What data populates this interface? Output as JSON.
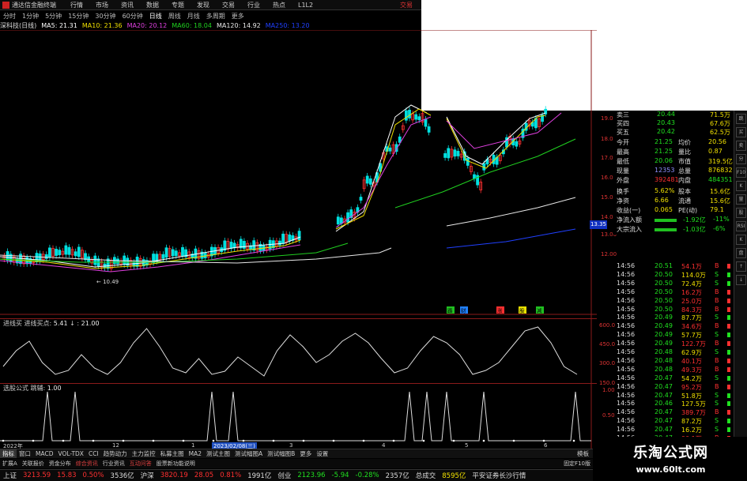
{
  "menubar": {
    "app_title": "通达信金融终端",
    "items": [
      "行情",
      "市场",
      "资讯",
      "数据",
      "专题",
      "发现",
      "交易",
      "行业",
      "热点",
      "L1L2"
    ],
    "right": "交易"
  },
  "periodbar": {
    "items": [
      "分时",
      "1分钟",
      "5分钟",
      "15分钟",
      "30分钟",
      "60分钟",
      "日线",
      "周线",
      "月线",
      "多周期",
      "更多"
    ],
    "active": 6
  },
  "ma_line": {
    "stock": "深科技(日线)",
    "items": [
      {
        "label": "MA5: 21.31",
        "color": "#ffffff"
      },
      {
        "label": "MA10: 21.36",
        "color": "#f0e000"
      },
      {
        "label": "MA20: 20.12",
        "color": "#e040e0"
      },
      {
        "label": "MA60: 18.04",
        "color": "#20d020"
      },
      {
        "label": "MA120: 14.92",
        "color": "#e8e8e8"
      },
      {
        "label": "MA250: 13.20",
        "color": "#2040ff"
      }
    ]
  },
  "axis": {
    "price": [
      "19.00",
      "18.00",
      "17.00",
      "16.00",
      "15.00",
      "14.00",
      "13.00",
      "12.00"
    ],
    "ind1": [
      "600.0",
      "450.0",
      "300.0",
      "150.0"
    ],
    "ind2": [
      "1.00",
      "0.50"
    ]
  },
  "price_tag": "13.35",
  "low_marker": "10.49",
  "indicators": {
    "ind1_title": "进线买",
    "ind1_label": "进线买点",
    "ind1_v1": "5.41",
    "ind1_v2": "21.00",
    "ind2_title": "选股公式",
    "ind2_label": "跳辅",
    "ind2_v": "1.00"
  },
  "quote": {
    "sells": [
      {
        "label": "卖三",
        "price": "20.44",
        "vol": "71.5万"
      },
      {
        "label": "买四",
        "price": "20.43",
        "vol": "67.6万"
      },
      {
        "label": "买五",
        "price": "20.42",
        "vol": "62.5万"
      }
    ],
    "stats": [
      {
        "l1": "今开",
        "v1": "21.25",
        "l2": "均价",
        "v2": "20.56"
      },
      {
        "l1": "最高",
        "v1": "21.25",
        "l2": "量比",
        "v2": "0.87"
      },
      {
        "l1": "最低",
        "v1": "20.06",
        "l2": "市值",
        "v2": "319.5亿"
      },
      {
        "l1": "现量",
        "v1": "12353",
        "l2": "总量",
        "v2": "876832"
      },
      {
        "l1": "外盘",
        "v1": "392481",
        "l2": "内盘",
        "v2": "484351"
      }
    ],
    "stats2": [
      {
        "l1": "换手",
        "v1": "5.62%",
        "l2": "股本",
        "v2": "15.6亿"
      },
      {
        "l1": "净资",
        "v1": "6.66",
        "l2": "流通",
        "v2": "15.6亿"
      },
      {
        "l1": "收益(一)",
        "v1": "0.065",
        "l2": "PE(动)",
        "v2": "79.1"
      }
    ],
    "flows": [
      {
        "label": "净流入额",
        "value": "-1.92亿",
        "pct": "-11%"
      },
      {
        "label": "大宗流入",
        "value": "-1.03亿",
        "pct": "-6%"
      }
    ]
  },
  "ticks": [
    {
      "t": "14:56",
      "p": "20.51",
      "v": "54.1万",
      "d": "B"
    },
    {
      "t": "14:56",
      "p": "20.50",
      "v": "114.0万",
      "d": "S"
    },
    {
      "t": "14:56",
      "p": "20.50",
      "v": "72.4万",
      "d": "S"
    },
    {
      "t": "14:56",
      "p": "20.50",
      "v": "16.2万",
      "d": "B"
    },
    {
      "t": "14:56",
      "p": "20.50",
      "v": "25.0万",
      "d": "B"
    },
    {
      "t": "14:56",
      "p": "20.50",
      "v": "84.3万",
      "d": "B"
    },
    {
      "t": "14:56",
      "p": "20.49",
      "v": "87.7万",
      "d": "S"
    },
    {
      "t": "14:56",
      "p": "20.49",
      "v": "34.6万",
      "d": "B"
    },
    {
      "t": "14:56",
      "p": "20.49",
      "v": "57.7万",
      "d": "S"
    },
    {
      "t": "14:56",
      "p": "20.49",
      "v": "122.7万",
      "d": "B"
    },
    {
      "t": "14:56",
      "p": "20.48",
      "v": "62.9万",
      "d": "S"
    },
    {
      "t": "14:56",
      "p": "20.48",
      "v": "40.1万",
      "d": "B"
    },
    {
      "t": "14:56",
      "p": "20.48",
      "v": "49.3万",
      "d": "B"
    },
    {
      "t": "14:56",
      "p": "20.47",
      "v": "54.2万",
      "d": "S"
    },
    {
      "t": "14:56",
      "p": "20.47",
      "v": "95.2万",
      "d": "B"
    },
    {
      "t": "14:56",
      "p": "20.47",
      "v": "51.8万",
      "d": "S"
    },
    {
      "t": "14:56",
      "p": "20.46",
      "v": "127.5万",
      "d": "S"
    },
    {
      "t": "14:56",
      "p": "20.47",
      "v": "389.7万",
      "d": "B"
    },
    {
      "t": "14:56",
      "p": "20.47",
      "v": "87.2万",
      "d": "S"
    },
    {
      "t": "14:56",
      "p": "20.47",
      "v": "16.2万",
      "d": "S"
    },
    {
      "t": "14:56",
      "p": "20.47",
      "v": "90.1万",
      "d": "B"
    },
    {
      "t": "14:56",
      "p": "20.47",
      "v": "28.7万",
      "d": "B"
    }
  ],
  "xaxis": {
    "labels": [
      "2022年",
      "12",
      "1",
      "2023/02/08(三)",
      "3",
      "4",
      "5",
      "6"
    ]
  },
  "tabbar": {
    "items": [
      "指标",
      "窗口",
      "MACD",
      "VOL-TDX",
      "CCI",
      "趋势动力",
      "主力监控",
      "私募主图",
      "MA2",
      "测试主图",
      "测试幅图A",
      "测试幅图B",
      "更多",
      "设置"
    ],
    "right": "模板"
  },
  "infobar": {
    "items": [
      "扩展A",
      "关联报价",
      "资金分布",
      "综合资讯",
      "行业资讯",
      "互动问答",
      "股票新功能说明"
    ],
    "right": "固定F10版"
  },
  "indexbar": [
    {
      "name": "上证",
      "val": "3213.59",
      "chg": "15.83",
      "pct": "0.50%",
      "amt": "3536亿"
    },
    {
      "name": "沪深",
      "val": "3820.19",
      "chg": "28.05",
      "pct": "0.81%",
      "amt": "1991亿"
    },
    {
      "name": "创业",
      "val": "2123.96",
      "chg": "-5.94",
      "pct": "-0.28%",
      "amt": "2357亿"
    },
    {
      "name": "总成交",
      "val": "8595亿",
      "chg": "",
      "pct": "",
      "amt": ""
    }
  ],
  "indexbar_right": "平安证券长沙行情",
  "events": [
    "路",
    "财",
    "涨",
    "股",
    "减"
  ],
  "watermark": {
    "title": "乐淘公式网",
    "url": "www.60lt.com"
  },
  "side_tools": [
    "跳",
    "买",
    "卖",
    "分",
    "F10",
    "K",
    "量",
    "股",
    "RSI",
    "K",
    "盘",
    "↑",
    "↓"
  ],
  "colors": {
    "up": "#ff3030",
    "down": "#00e0e0",
    "accent": "#e8e000",
    "panel_border": "#8a1a1a"
  }
}
